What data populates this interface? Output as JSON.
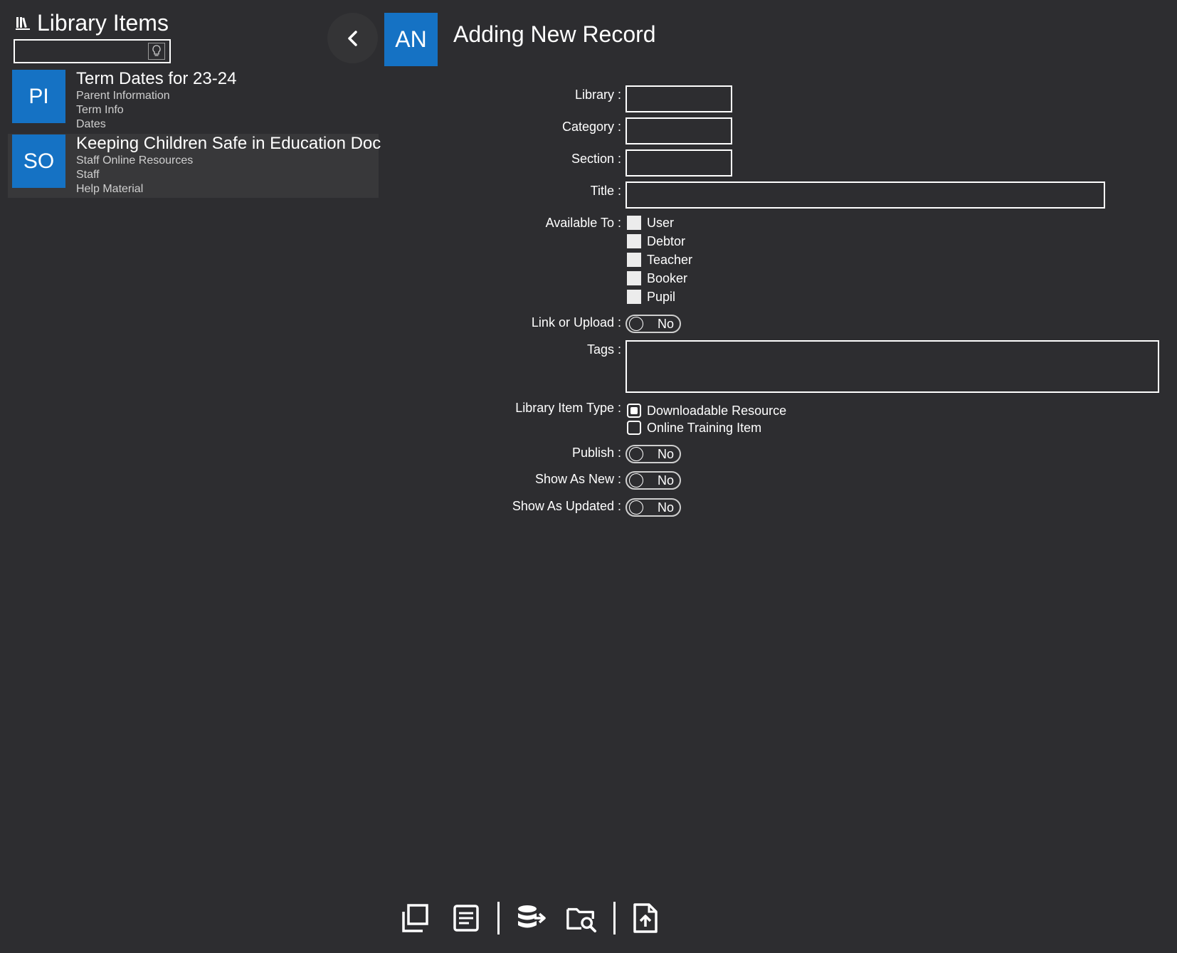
{
  "left_panel": {
    "title": "Library Items",
    "search": {
      "value": "",
      "placeholder": ""
    },
    "items": [
      {
        "avatar": "PI",
        "title": "Term Dates for 23-24",
        "lines": [
          "Parent Information",
          "Term Info",
          "Dates"
        ]
      },
      {
        "avatar": "SO",
        "title": "Keeping Children Safe in Education Doc",
        "lines": [
          "Staff Online Resources",
          "Staff",
          "Help Material"
        ]
      }
    ]
  },
  "header": {
    "avatar": "AN",
    "title": "Adding New Record"
  },
  "form": {
    "library_label": "Library :",
    "category_label": "Category :",
    "section_label": "Section :",
    "title_label": "Title :",
    "available_to_label": "Available To :",
    "available_to_options": [
      "User",
      "Debtor",
      "Teacher",
      "Booker",
      "Pupil"
    ],
    "link_or_upload_label": "Link or Upload :",
    "link_or_upload_state": "No",
    "tags_label": "Tags :",
    "item_type_label": "Library Item Type :",
    "item_type_options": [
      "Downloadable Resource",
      "Online Training Item"
    ],
    "item_type_selected": "Downloadable Resource",
    "publish_label": "Publish :",
    "publish_state": "No",
    "show_as_new_label": "Show As New :",
    "show_as_new_state": "No",
    "show_as_updated_label": "Show As Updated :",
    "show_as_updated_state": "No"
  },
  "toolbar": {
    "icons": [
      "copy-icon",
      "document-icon",
      "database-export-icon",
      "folder-search-icon",
      "file-upload-icon"
    ]
  },
  "colors": {
    "background": "#2d2d30",
    "accent": "#1572c4",
    "selected_row": "#38383a"
  }
}
